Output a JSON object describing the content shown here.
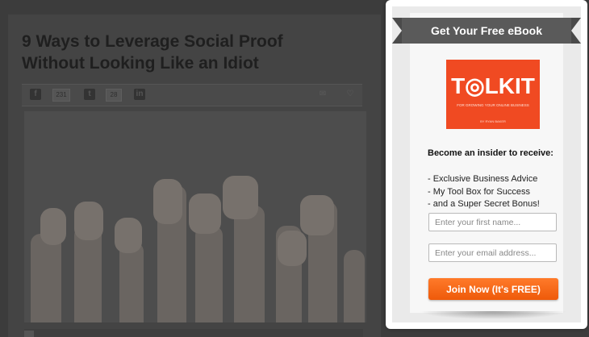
{
  "article": {
    "title_line1": "9 Ways to Leverage Social Proof",
    "title_line2": "Without Looking Like an Idiot",
    "share": {
      "facebook_count": "231",
      "twitter_count": "28"
    }
  },
  "popup": {
    "ribbon": "Get Your Free eBook",
    "book": {
      "title": "T◎LKIT",
      "subtitle": "FOR GROWING YOUR ONLINE BUSINESS",
      "author": "BY RYAN BAKER"
    },
    "heading": "Become an insider to receive:",
    "benefits": [
      "- Exclusive Business Advice",
      "- My Tool Box for Success",
      "- and a Super Secret Bonus!"
    ],
    "first_name_placeholder": "Enter your first name...",
    "email_placeholder": "Enter your email address...",
    "button_label": "Join Now (It's FREE)",
    "colors": {
      "accent": "#ee5a0a",
      "book": "#f04a22",
      "ribbon": "#5a5a5a"
    }
  }
}
